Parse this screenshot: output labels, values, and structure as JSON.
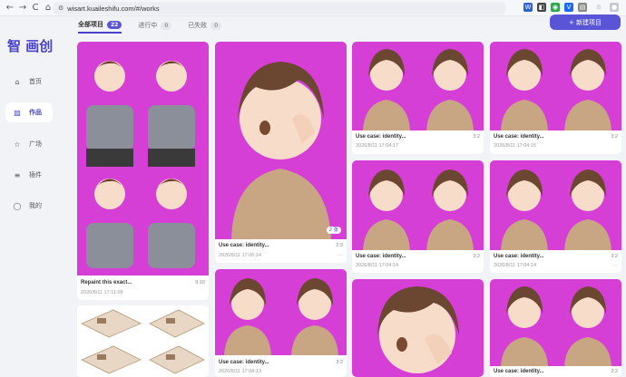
{
  "browser": {
    "url": "wisart.kuaileshifu.com/#/works",
    "back_icon": "←",
    "forward_icon": "→",
    "reload_icon": "C",
    "home_icon": "⌂"
  },
  "app": {
    "logo_char": "智",
    "logo_text": "画创"
  },
  "sidebar": {
    "items": [
      {
        "label": "首页",
        "icon": "home-icon"
      },
      {
        "label": "作品",
        "icon": "image-icon"
      },
      {
        "label": "广场",
        "icon": "star-icon"
      },
      {
        "label": "插件",
        "icon": "sliders-icon"
      },
      {
        "label": "我的",
        "icon": "user-icon"
      }
    ]
  },
  "tabs": [
    {
      "label": "全部项目",
      "count": "22"
    },
    {
      "label": "进行中",
      "count": "0"
    },
    {
      "label": "已失败",
      "count": "0"
    }
  ],
  "new_button": "+ 新建项目",
  "cards": [
    {
      "title": "Repaint this exact...",
      "ratio": "9:16",
      "date": "2026/8/11 17:11:09"
    },
    {
      "title": "Use case: identity...",
      "ratio": "2:3",
      "date": "2026/8/11 17:06:14",
      "badge": "2 张"
    },
    {
      "title": "Use case: identity...",
      "ratio": "3:2",
      "date": "2026/8/11 17:04:13"
    },
    {
      "title": "Use case: identity...",
      "ratio": "3:2",
      "date": "2026/8/11 17:04:17"
    },
    {
      "title": "Use case: identity...",
      "ratio": "3:2",
      "date": "2026/8/11 17:04:14"
    },
    {
      "title": "Use case: identity...",
      "ratio": "3:2",
      "date": "2026/8/11 17:04:15"
    },
    {
      "title": "Use case: identity...",
      "ratio": "3:2",
      "date": "2026/8/11 17:04:14"
    },
    {
      "title": "Use case: identity...",
      "ratio": "3:2",
      "date": ""
    },
    {
      "title": "Use case: identity...",
      "ratio": "3:2",
      "date": ""
    }
  ],
  "more_glyph": "···",
  "colors": {
    "accent": "#5a54d6",
    "thumb_bg": "#d63fd6"
  }
}
